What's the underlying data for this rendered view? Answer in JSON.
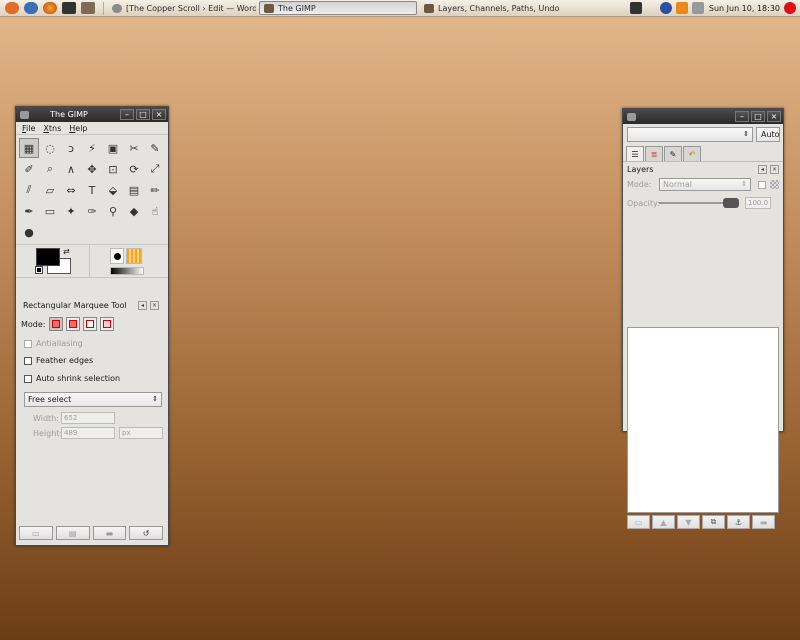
{
  "colors": {
    "desktop_top": "#e3b98d",
    "desktop_bottom": "#6b3d17",
    "titlebar": "#2f2f2f",
    "window_bg": "#e4e3e0",
    "selection_red": "#f06b6b"
  },
  "panel": {
    "launchers": [
      "ubuntu-menu-icon",
      "web-browser-icon",
      "firefox-icon",
      "terminal-icon",
      "gimp-launcher-icon"
    ],
    "tasks": [
      {
        "label": "[The Copper Scroll › Edit — WordP…",
        "icon": "wordpress-icon",
        "active": false
      },
      {
        "label": "The GIMP",
        "icon": "gimp-icon",
        "active": true
      },
      {
        "label": "Layers, Channels, Paths, Undo",
        "icon": "gimp-icon",
        "active": false
      }
    ],
    "clock": "Sun Jun 10, 18:30"
  },
  "toolbox": {
    "title": "The GIMP",
    "menu": [
      "File",
      "Xtns",
      "Help"
    ],
    "tools": [
      "rect-select-icon",
      "ellipse-select-icon",
      "free-select-icon",
      "fuzzy-select-icon",
      "color-select-icon",
      "scissors-icon",
      "paths-icon",
      "color-picker-icon",
      "zoom-icon",
      "measure-icon",
      "move-icon",
      "crop-icon",
      "rotate-icon",
      "scale-icon",
      "shear-icon",
      "perspective-icon",
      "flip-icon",
      "text-icon",
      "bucket-fill-icon",
      "blend-icon",
      "pencil-icon",
      "paintbrush-icon",
      "eraser-icon",
      "airbrush-icon",
      "ink-icon",
      "clone-icon",
      "convolve-icon",
      "smudge-icon",
      "dodge-burn-icon"
    ],
    "tool_glyphs": [
      "▦",
      "◌",
      "ↄ",
      "⚡",
      "▣",
      "✂",
      "✎",
      "✐",
      "⌕",
      "∧",
      "✥",
      "⊡",
      "⟳",
      "⤢",
      "⫽",
      "▱",
      "⇔",
      "T",
      "⬙",
      "▤",
      "✏",
      "✒",
      "▭",
      "✦",
      "✑",
      "⚲",
      "◆",
      "☝",
      "●"
    ]
  },
  "tool_options": {
    "title": "Rectangular Marquee Tool",
    "mode_label": "Mode:",
    "antialiasing": "Antialiasing",
    "feather": "Feather edges",
    "auto_shrink": "Auto shrink selection",
    "select_mode": "Free select",
    "width_label": "Width:",
    "width_value": "652",
    "height_label": "Height:",
    "height_value": "489",
    "unit": "px"
  },
  "layers": {
    "title": "Layers",
    "auto_label": "Auto",
    "mode_label": "Mode:",
    "mode_value": "Normal",
    "opacity_label": "Opacity:",
    "opacity_value": "100.0",
    "opacity_fraction": 1.0,
    "tabs": [
      "layers-tab-icon",
      "channels-tab-icon",
      "paths-tab-icon",
      "undo-tab-icon"
    ],
    "buttons": [
      "new-layer-icon",
      "raise-layer-icon",
      "lower-layer-icon",
      "duplicate-layer-icon",
      "anchor-layer-icon",
      "delete-layer-icon"
    ]
  }
}
